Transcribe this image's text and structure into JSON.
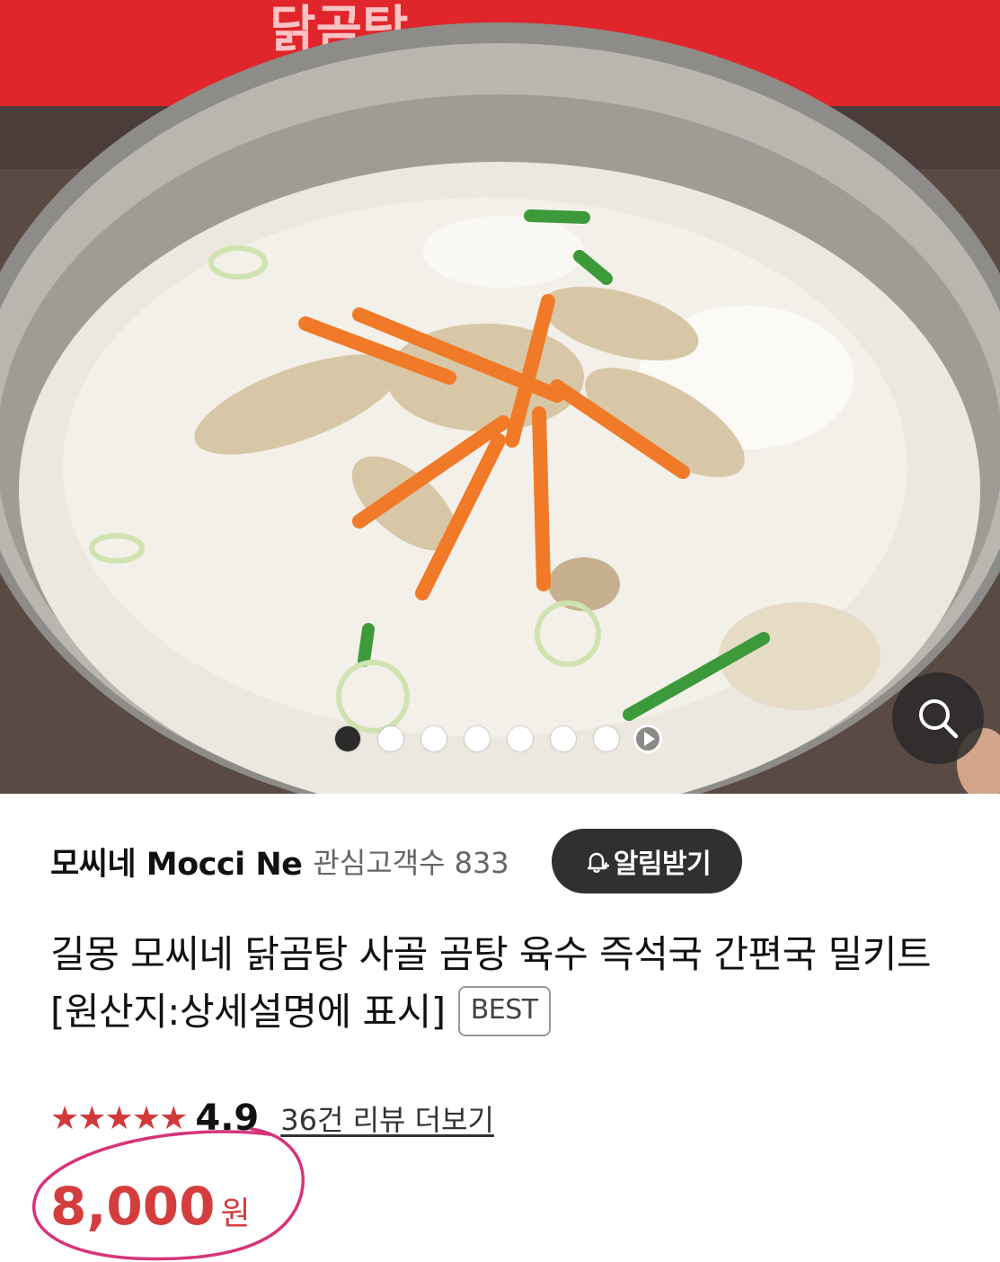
{
  "gallery": {
    "slide_count": 7,
    "active_index": 0,
    "banner_text": "닭곰탕"
  },
  "seller": {
    "name": "모씨네 Mocci Ne",
    "interest_label": "관심고객수",
    "interest_count": "833",
    "alarm_label": "알림받기"
  },
  "product": {
    "title": "길몽 모씨네 닭곰탕 사골 곰탕 육수 즉석국 간편국 밀키트 [원산지:상세설명에 표시]",
    "badge": "BEST"
  },
  "rating": {
    "stars": "★★★★★",
    "score": "4.9",
    "review_link": "36건 리뷰 더보기"
  },
  "price": {
    "amount": "8,000",
    "currency": "원"
  },
  "colors": {
    "accent_red": "#d43d3d",
    "star_red": "#d23a3a",
    "banner_red": "#e0262b",
    "dark_button": "#303030",
    "annotation_pink": "#d6337a"
  }
}
